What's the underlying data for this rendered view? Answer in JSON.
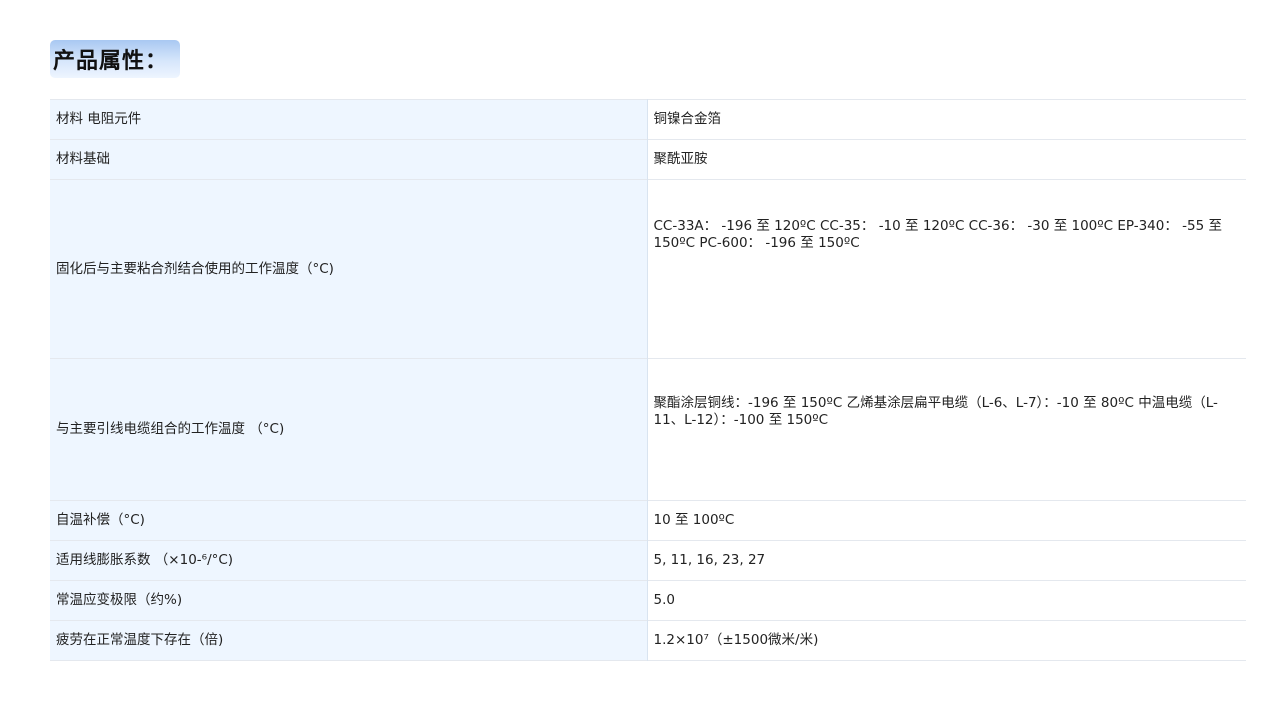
{
  "section_title": "产品属性：",
  "rows": [
    {
      "key": "材料 电阻元件",
      "value": "铜镍合金箔"
    },
    {
      "key": "材料基础",
      "value": "聚酰亚胺"
    },
    {
      "key": "固化后与主要粘合剂结合使用的工作温度（°C)",
      "value": "CC-33A： -196 至 120ºC CC-35： -10 至 120ºC CC-36： -30 至 100ºC EP-340： -55 至 150ºC PC-600： -196 至 150ºC"
    },
    {
      "key": "与主要引线电缆组合的工作温度 （°C)",
      "value": "聚酯涂层铜线：-196 至 150ºC 乙烯基涂层扁平电缆（L-6、L-7）：-10 至 80ºC 中温电缆（L-11、L-12）：-100 至 150ºC"
    },
    {
      "key": "自温补偿（°C)",
      "value": "10 至 100ºC"
    },
    {
      "key": "适用线膨胀系数 （×10-⁶/°C)",
      "value": "5, 11, 16, 23, 27"
    },
    {
      "key": "常温应变极限（约%)",
      "value": "5.0"
    },
    {
      "key": "疲劳在正常温度下存在（倍)",
      "value": "1.2×10⁷（±1500微米/米)"
    }
  ]
}
